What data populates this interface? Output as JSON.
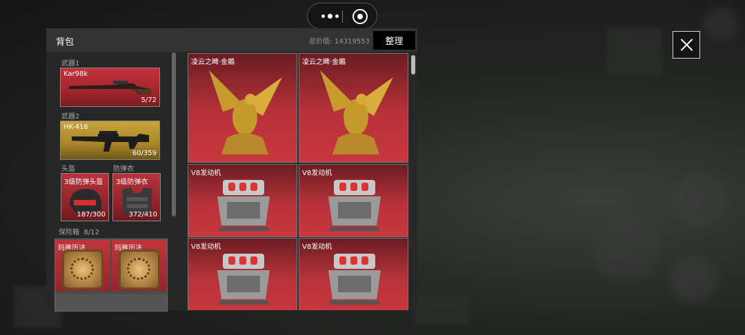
{
  "header": {
    "title": "背包",
    "total_label": "总价值:",
    "total_value": "14319553",
    "sort_label": "整理"
  },
  "weapons": [
    {
      "slot_label": "武器1",
      "name": "Kar98k",
      "ammo": "5/72"
    },
    {
      "slot_label": "武器2",
      "name": "HK-416",
      "ammo": "60/359"
    }
  ],
  "gear": [
    {
      "slot_label": "头盔",
      "name": "3级防弹头盔",
      "durability": "187/300"
    },
    {
      "slot_label": "防弹衣",
      "name": "3级防弹衣",
      "durability": "372/410"
    }
  ],
  "safe": {
    "label": "保险箱",
    "count": "8/12",
    "items": [
      {
        "name": "玛雅历法"
      },
      {
        "name": "玛雅历法"
      }
    ]
  },
  "inventory": [
    {
      "name": "凌云之睥·金鵰",
      "icon": "golden-eagle-icon"
    },
    {
      "name": "凌云之睥·金鵰",
      "icon": "golden-eagle-icon"
    },
    {
      "name": "V8发动机",
      "icon": "v8-engine-icon"
    },
    {
      "name": "V8发动机",
      "icon": "v8-engine-icon"
    },
    {
      "name": "V8发动机",
      "icon": "v8-engine-icon"
    },
    {
      "name": "V8发动机",
      "icon": "v8-engine-icon"
    }
  ]
}
